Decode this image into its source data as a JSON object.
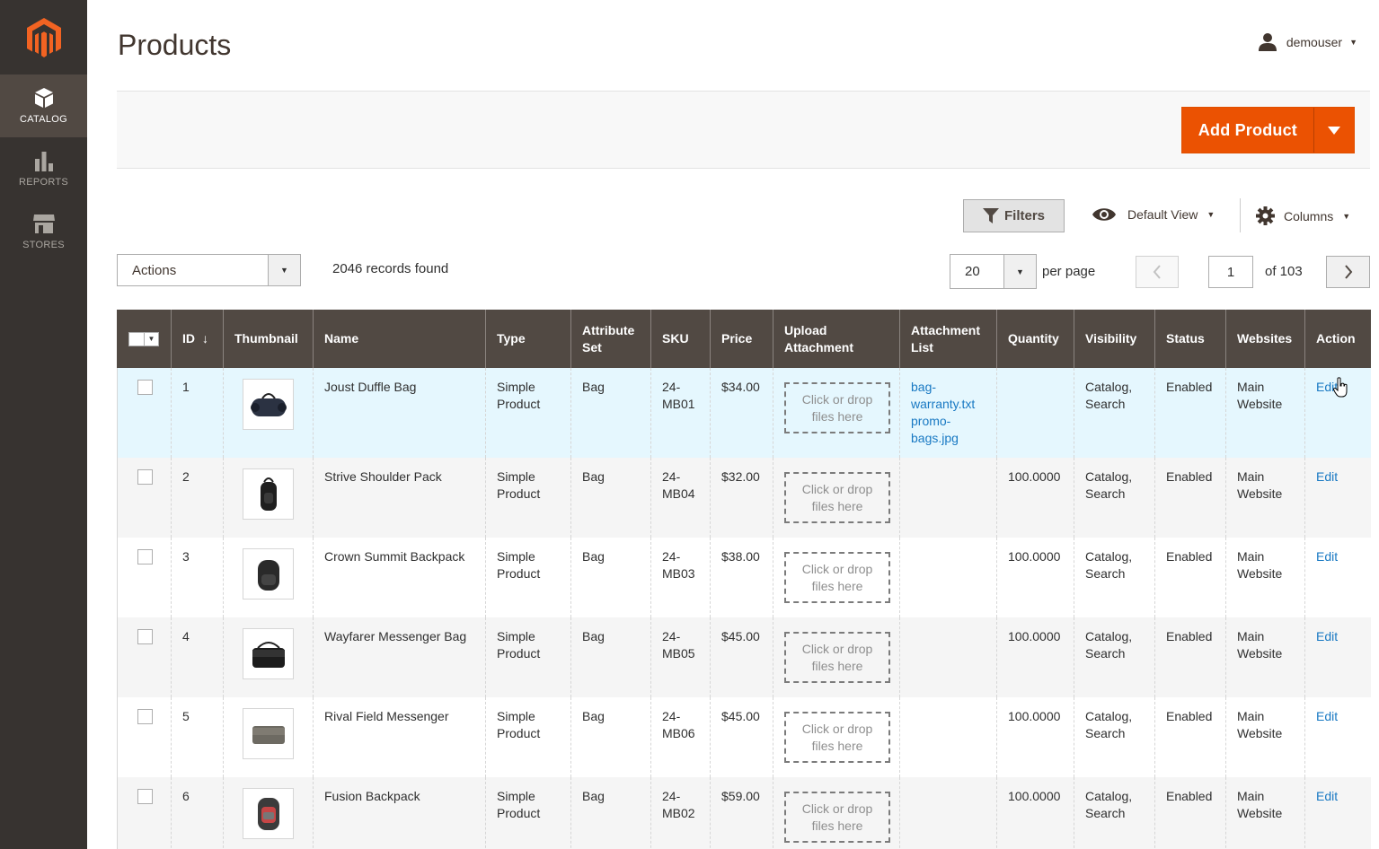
{
  "sidebar": {
    "items": [
      {
        "label": "CATALOG",
        "icon": "cube-icon",
        "active": true
      },
      {
        "label": "REPORTS",
        "icon": "bar-chart-icon",
        "active": false
      },
      {
        "label": "STORES",
        "icon": "store-icon",
        "active": false
      }
    ]
  },
  "header": {
    "title": "Products",
    "user": "demouser"
  },
  "action_bar": {
    "add_label": "Add Product"
  },
  "toolbar": {
    "filters_label": "Filters",
    "view_label": "Default View",
    "columns_label": "Columns",
    "actions_label": "Actions",
    "records_text": "2046 records found",
    "per_page_value": "20",
    "per_page_label": "per page",
    "page_value": "1",
    "of_label": "of 103"
  },
  "colors": {
    "sidebar": "#373330",
    "accent": "#eb5202",
    "header_bg": "#514943",
    "link": "#1979c3"
  },
  "grid": {
    "columns": [
      "ID",
      "Thumbnail",
      "Name",
      "Type",
      "Attribute Set",
      "SKU",
      "Price",
      "Upload Attachment",
      "Attachment List",
      "Quantity",
      "Visibility",
      "Status",
      "Websites",
      "Action"
    ],
    "rows": [
      {
        "id": "1",
        "name": "Joust Duffle Bag",
        "type": "Simple Product",
        "set": "Bag",
        "sku": "24-MB01",
        "price": "$34.00",
        "upload": "Click or drop files here",
        "attachments": [
          "bag-warranty.txt",
          "promo-bags.jpg"
        ],
        "qty": "",
        "visibility": "Catalog, Search",
        "status": "Enabled",
        "websites": "Main Website",
        "action": "Edit"
      },
      {
        "id": "2",
        "name": "Strive Shoulder Pack",
        "type": "Simple Product",
        "set": "Bag",
        "sku": "24-MB04",
        "price": "$32.00",
        "upload": "Click or drop files here",
        "attachments": [],
        "qty": "100.0000",
        "visibility": "Catalog, Search",
        "status": "Enabled",
        "websites": "Main Website",
        "action": "Edit"
      },
      {
        "id": "3",
        "name": "Crown Summit Backpack",
        "type": "Simple Product",
        "set": "Bag",
        "sku": "24-MB03",
        "price": "$38.00",
        "upload": "Click or drop files here",
        "attachments": [],
        "qty": "100.0000",
        "visibility": "Catalog, Search",
        "status": "Enabled",
        "websites": "Main Website",
        "action": "Edit"
      },
      {
        "id": "4",
        "name": "Wayfarer Messenger Bag",
        "type": "Simple Product",
        "set": "Bag",
        "sku": "24-MB05",
        "price": "$45.00",
        "upload": "Click or drop files here",
        "attachments": [],
        "qty": "100.0000",
        "visibility": "Catalog, Search",
        "status": "Enabled",
        "websites": "Main Website",
        "action": "Edit"
      },
      {
        "id": "5",
        "name": "Rival Field Messenger",
        "type": "Simple Product",
        "set": "Bag",
        "sku": "24-MB06",
        "price": "$45.00",
        "upload": "Click or drop files here",
        "attachments": [],
        "qty": "100.0000",
        "visibility": "Catalog, Search",
        "status": "Enabled",
        "websites": "Main Website",
        "action": "Edit"
      },
      {
        "id": "6",
        "name": "Fusion Backpack",
        "type": "Simple Product",
        "set": "Bag",
        "sku": "24-MB02",
        "price": "$59.00",
        "upload": "Click or drop files here",
        "attachments": [],
        "qty": "100.0000",
        "visibility": "Catalog, Search",
        "status": "Enabled",
        "websites": "Main Website",
        "action": "Edit"
      }
    ]
  }
}
